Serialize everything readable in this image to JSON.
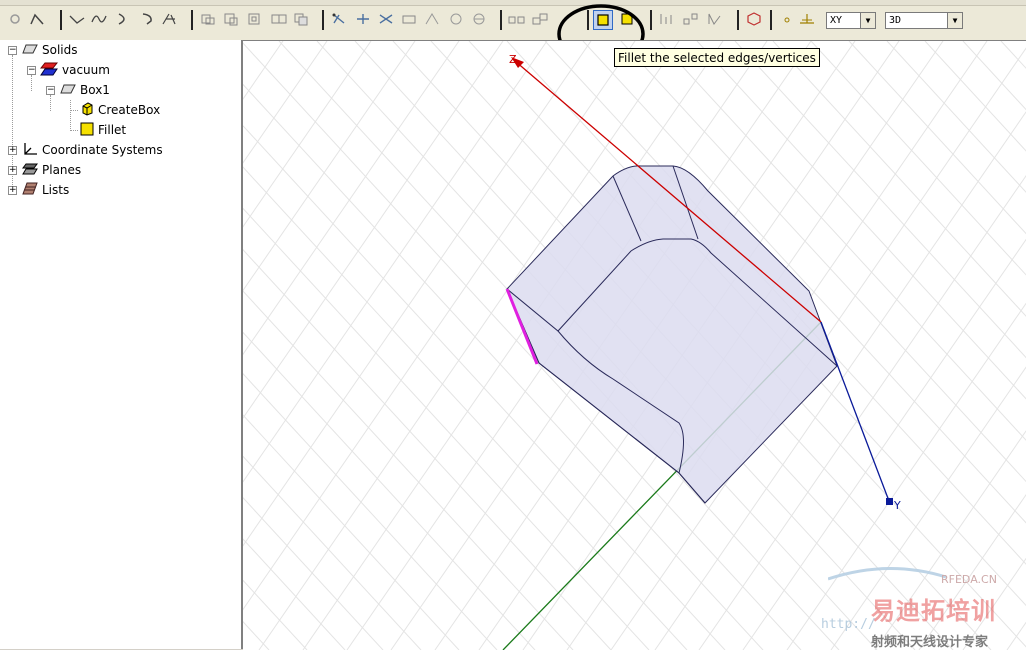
{
  "toolbar": {
    "plane_select": {
      "value": "XY"
    },
    "view_select": {
      "value": "3D"
    },
    "tooltip": "Fillet the selected edges/vertices",
    "highlight_color": "#000000"
  },
  "tree": {
    "items": [
      {
        "label": "Solids",
        "icon": "solids-icon",
        "expander": "−"
      },
      {
        "label": "vacuum",
        "icon": "material-icon",
        "expander": "−"
      },
      {
        "label": "Box1",
        "icon": "box-icon",
        "expander": "−"
      },
      {
        "label": "CreateBox",
        "icon": "createbox-icon"
      },
      {
        "label": "Fillet",
        "icon": "fillet-icon"
      },
      {
        "label": "Coordinate Systems",
        "icon": "coordinate-systems-icon",
        "expander": "+"
      },
      {
        "label": "Planes",
        "icon": "planes-icon",
        "expander": "+"
      },
      {
        "label": "Lists",
        "icon": "lists-icon",
        "expander": "+"
      }
    ]
  },
  "viewport": {
    "axes": {
      "z": "Z",
      "y": "Y"
    },
    "colors": {
      "z_axis": "#cc0000",
      "y_axis": "#0a1a99",
      "x_axis": "#1a7a1a",
      "selected_edge": "#e020e0",
      "box_fill": "#dcdcf0",
      "box_edge": "#2a2a5a"
    }
  },
  "watermark": {
    "brand": "易迪拓培训",
    "site": "RFEDA.CN",
    "subtitle": "射频和天线设计专家",
    "url": "http://"
  }
}
